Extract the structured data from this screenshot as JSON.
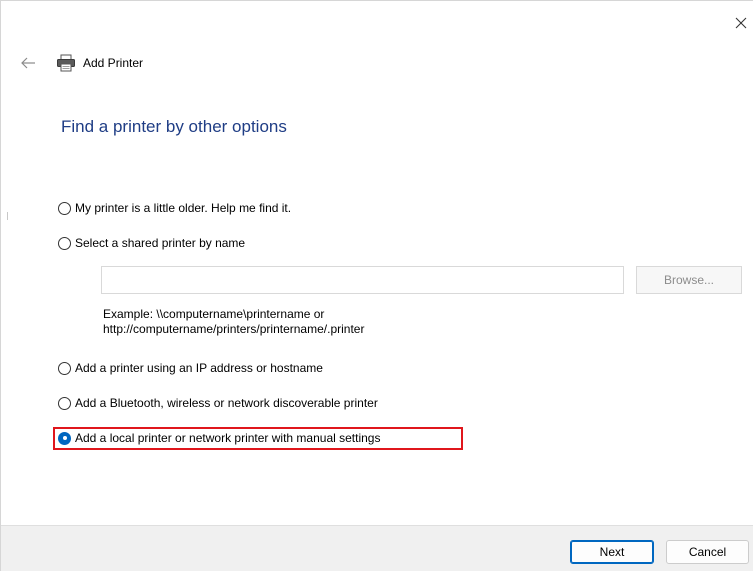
{
  "window": {
    "title": "Add Printer"
  },
  "heading": "Find a printer by other options",
  "options": [
    {
      "label": "My printer is a little older. Help me find it.",
      "selected": false
    },
    {
      "label": "Select a shared printer by name",
      "selected": false
    },
    {
      "label": "Add a printer using an IP address or hostname",
      "selected": false
    },
    {
      "label": "Add a Bluetooth, wireless or network discoverable printer",
      "selected": false
    },
    {
      "label": "Add a local printer or network printer with manual settings",
      "selected": true
    }
  ],
  "shared_printer": {
    "value": "",
    "browse_label": "Browse...",
    "example_line1": "Example: \\\\computername\\printername or",
    "example_line2": "http://computername/printers/printername/.printer"
  },
  "footer": {
    "next_label": "Next",
    "cancel_label": "Cancel"
  },
  "colors": {
    "heading": "#1f3d85",
    "accent": "#0067c0",
    "highlight": "#e0161c",
    "footer_bg": "#f0f0f0"
  },
  "icons": {
    "close": "close-icon",
    "back": "back-arrow-icon",
    "printer": "printer-icon"
  }
}
